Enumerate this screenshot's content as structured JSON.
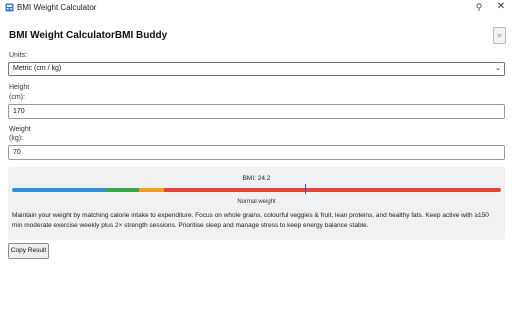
{
  "window": {
    "title": "BMI Weight Calculator",
    "icons": {
      "app": "calculator-icon",
      "pin": "pin-icon",
      "close": "close-icon"
    }
  },
  "header": {
    "title": "BMI Weight CalculatorBMI Buddy",
    "theme_toggle_label": "☼"
  },
  "form": {
    "units_label": "Units:",
    "units_value": "Metric (cm / kg)",
    "height_label": "Height",
    "height_unit": "(cm):",
    "height_value": "170",
    "weight_label": "Weight",
    "weight_unit": "(kg):",
    "weight_value": "70"
  },
  "result": {
    "bmi_text": "BMI: 24.2",
    "bmi": 24.2,
    "category": "Normal weight",
    "marker_fraction": 0.6,
    "scale_colors": {
      "underweight": "#2f8fe0",
      "normal": "#3aa64a",
      "overweight": "#f0a020",
      "obese": "#e4453a"
    },
    "advice": "Maintain your weight by matching calorie intake to expenditure. Focus on whole grains, colourful veggies & fruit, lean proteins, and healthy fats. Keep active with ≥150 min moderate exercise weekly plus 2× strength sessions. Prioritise sleep and manage stress to keep energy balance stable."
  },
  "actions": {
    "copy_label": "Copy Result"
  }
}
